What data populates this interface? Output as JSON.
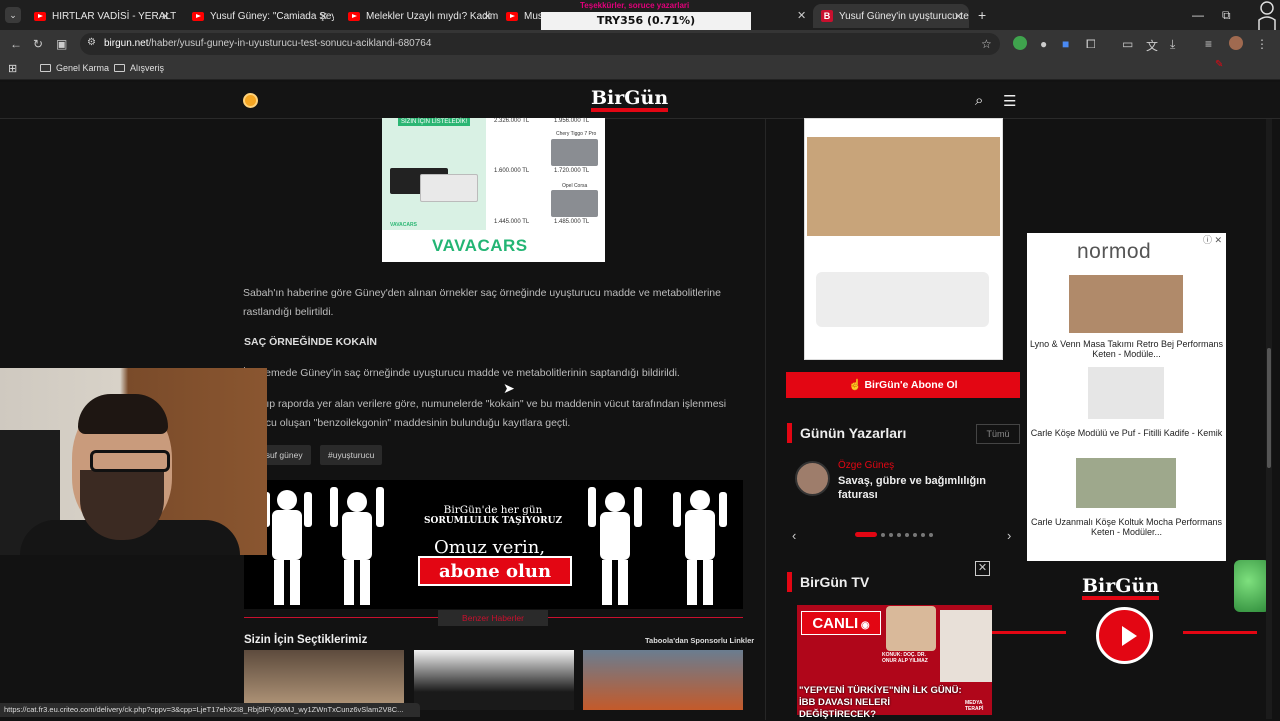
{
  "browser": {
    "tabs": [
      {
        "label": "HIRTLAR VADİSİ - YERALTI DİZİ",
        "icon": "youtube-icon"
      },
      {
        "label": "Yusuf Güney: \"Camiada Şeytan",
        "icon": "youtube-icon"
      },
      {
        "label": "Melekler Uzaylı mıydı? Kadim M",
        "icon": "youtube-icon"
      },
      {
        "label": "Musa",
        "icon": "youtube-icon"
      },
      {
        "label": "Yusuf Güney'in uyuşturucu test",
        "icon": "birgun-icon",
        "active": true
      }
    ],
    "url_host": "birgun.net",
    "url_path": "/haber/yusuf-guney-in-uyusturucu-test-sonucu-aciklandi-680764",
    "bookmarks": [
      "Genel Karma",
      "Alışveriş"
    ],
    "status_url": "https://cat.fr3.eu.criteo.com/delivery/ck.php?cppv=3&cpp=LjeT17ehX2I8_Rbj5lFVj06MJ_wy1ZWnTxCunz6vSlam2V8C..."
  },
  "overlay": {
    "ticker_small": "Teşekkürler, soruce yazarlari",
    "ticker": "TRY356 (0.71%)"
  },
  "site": {
    "logo": "BirGün"
  },
  "ad_cars": {
    "badge": "SIZIN İÇIN LİSTELEDİK!",
    "prices": [
      "2.326.000 TL",
      "1.956.000 TL",
      "1.600.000 TL",
      "1.720.000 TL",
      "1.445.000 TL",
      "1.485.000 TL"
    ],
    "model_labels": [
      "Chery Tiggo 7 Pro",
      "Opel Corsa"
    ],
    "small_brand": "VAVACARS",
    "brand": "VAVACARS"
  },
  "article": {
    "para1": "Sabah'ın haberine göre Güney'den alınan örnekler saç örneğinde uyuşturucu madde ve metabolitlerine rastlandığı belirtildi.",
    "subheading": "SAÇ ÖRNEĞİNDE KOKAİN",
    "para2": "İncelemede Güney'in saç örneğinde uyuşturucu madde ve metabolitlerinin saptandığı bildirildi.",
    "para3": "Adli tıp raporda yer alan verilere göre, numunelerde \"kokain\" ve bu maddenin vücut tarafından işlenmesi sonucu oluşan \"benzoilekgonin\" maddesinin bulunduğu kayıtlara geçti.",
    "tags": [
      "#yusuf güney",
      "#uyuşturucu"
    ],
    "banner_line1": "BirGün'de her gün",
    "banner_line2": "SORUMLULUK TAŞIYORUZ",
    "banner_cta1": "Omuz verin,",
    "banner_cta2": "abone olun",
    "more_button": "Benzer Haberler",
    "picks_title": "Sizin İçin Seçtiklerimiz",
    "taboola": "Taboola'dan Sponsorlu Linkler"
  },
  "sidebar": {
    "subscribe": "BirGün'e Abone Ol",
    "writers_title": "Günün Yazarları",
    "writers_all": "Tümü",
    "writer_name": "Özge Güneş",
    "writer_article": "Savaş, gübre ve bağımlılığın faturası",
    "tv_title": "BirGün TV",
    "live_badge": "CANLI",
    "tv_person_label": "KONUK: DOÇ. DR. ONUR ALP YILMAZ",
    "tv_caption": "\"YEPYENİ TÜRKİYE\"NİN İLK GÜNÜ: İBB DAVASI NELERİ DEĞİŞTİRECEK?",
    "tv_right_label": "MEDYA TERAPİ"
  },
  "normod_ad": {
    "logo": "normod",
    "items": [
      "Lyno & Venn Masa Takımı Retro Bej Performans Keten - Modüle...",
      "Carle Köşe Modülü ve Puf - Fitilli Kadife - Kemik",
      "Carle Uzanmalı Köşe Koltuk Mocha Performans Keten - Modüler..."
    ]
  },
  "player": {
    "logo": "BirGün"
  },
  "colors": {
    "brand_red": "#e30613",
    "background": "#121212",
    "vavacars_green": "#23b574"
  }
}
